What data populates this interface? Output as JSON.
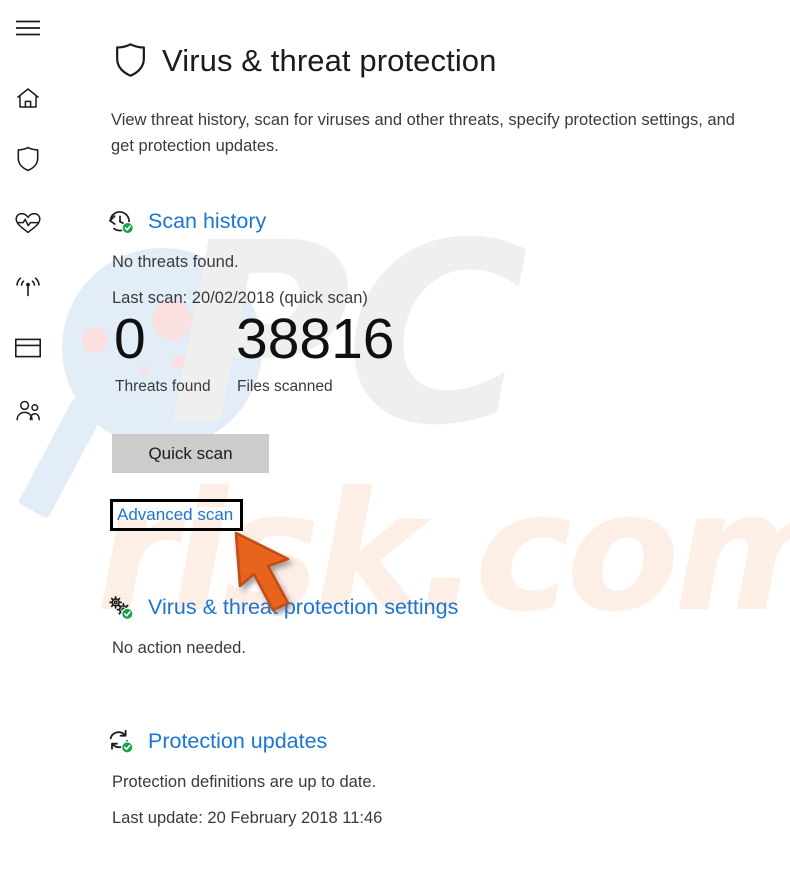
{
  "window": {
    "title": "Virus & threat protection"
  },
  "colors": {
    "link_blue": "#1a76d2",
    "accent_green": "#16a34a",
    "button_gray": "#cccccc",
    "arrow_orange": "#e8641c",
    "arrow_orange_dark": "#c24d12",
    "highlight_border": "#000000",
    "text_primary": "#1b1b1b",
    "text_secondary": "#3a3a3a"
  },
  "sidebar": {
    "items": [
      {
        "icon": "hamburger-menu-icon",
        "label": "Menu"
      },
      {
        "icon": "home-icon",
        "label": "Home"
      },
      {
        "icon": "shield-icon",
        "label": "Virus & threat protection"
      },
      {
        "icon": "heart-pulse-icon",
        "label": "Device performance & health"
      },
      {
        "icon": "wifi-signal-icon",
        "label": "Firewall & network protection"
      },
      {
        "icon": "browser-window-icon",
        "label": "App & browser control"
      },
      {
        "icon": "family-people-icon",
        "label": "Family options"
      }
    ]
  },
  "header": {
    "icon": "shield-icon",
    "title": "Virus & threat protection",
    "description": "View threat history, scan for viruses and other threats, specify protection settings, and get protection updates."
  },
  "sections": {
    "scan_history": {
      "icon": "scan-history-clock-icon",
      "title": "Scan history",
      "status": "No threats found.",
      "last_scan": "Last scan: 20/02/2018 (quick scan)",
      "stats": [
        {
          "value": "0",
          "label": "Threats found"
        },
        {
          "value": "38816",
          "label": "Files scanned"
        }
      ],
      "quick_scan_label": "Quick scan",
      "advanced_scan_label": "Advanced scan"
    },
    "protection_settings": {
      "icon": "gears-icon",
      "title": "Virus & threat protection settings",
      "status": "No action needed."
    },
    "protection_updates": {
      "icon": "refresh-sync-icon",
      "title": "Protection updates",
      "status": "Protection definitions are up to date.",
      "last_update": "Last update: 20 February 2018 11:46"
    }
  },
  "annotation": {
    "arrow": "orange-cursor-arrow",
    "points_at": "Advanced scan"
  },
  "watermark": {
    "primary_text": "PC",
    "secondary_text": "risk.com",
    "shape": "magnifying-glass"
  }
}
